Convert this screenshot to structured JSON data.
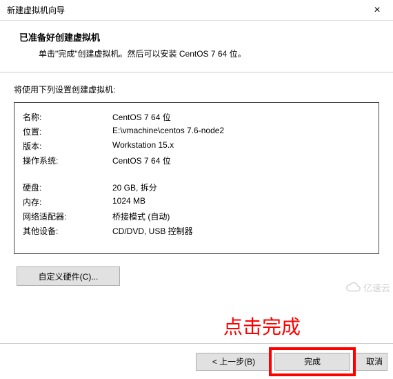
{
  "window": {
    "title": "新建虚拟机向导",
    "close_glyph": "×"
  },
  "header": {
    "title": "已准备好创建虚拟机",
    "description": "单击\"完成\"创建虚拟机。然后可以安装 CentOS 7 64 位。"
  },
  "content": {
    "intro": "将使用下列设置创建虚拟机:",
    "rows": [
      {
        "label": "名称:",
        "value": "CentOS 7 64 位"
      },
      {
        "label": "位置:",
        "value": "E:\\vmachine\\centos 7.6-node2"
      },
      {
        "label": "版本:",
        "value": "Workstation 15.x"
      },
      {
        "label": "操作系统:",
        "value": "CentOS 7 64 位"
      }
    ],
    "rows2": [
      {
        "label": "硬盘:",
        "value": "20 GB, 拆分"
      },
      {
        "label": "内存:",
        "value": "1024 MB"
      },
      {
        "label": "网络适配器:",
        "value": "桥接模式 (自动)"
      },
      {
        "label": "其他设备:",
        "value": "CD/DVD, USB 控制器"
      }
    ],
    "custom_hw_label": "自定义硬件(C)..."
  },
  "annotation": {
    "text": "点击完成"
  },
  "footer": {
    "back_label": "< 上一步(B)",
    "finish_label": "完成",
    "cancel_label": "取消"
  },
  "watermark": {
    "text": "亿速云"
  }
}
